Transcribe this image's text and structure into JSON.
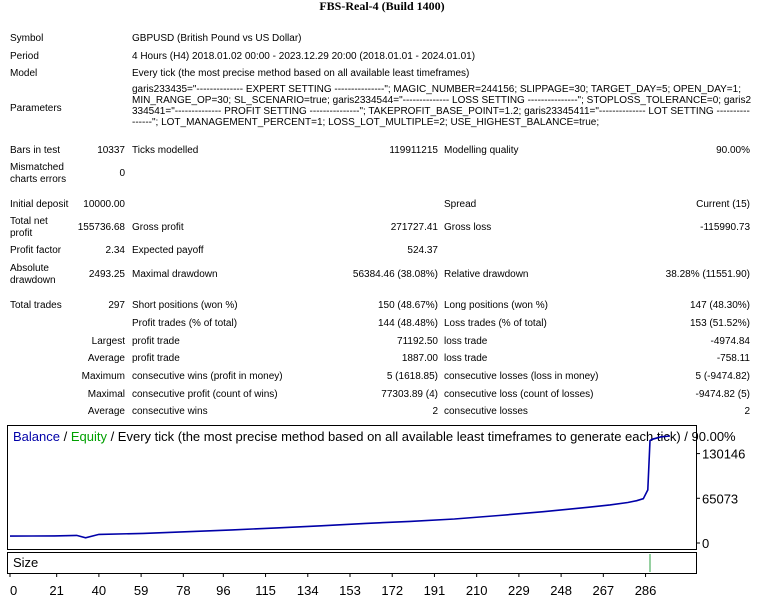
{
  "report": {
    "title": "FBS-Real-4 (Build 1400)",
    "symbol": {
      "label": "Symbol",
      "value": "GBPUSD (British Pound vs US Dollar)"
    },
    "period": {
      "label": "Period",
      "value": "4 Hours (H4) 2018.01.02 00:00 - 2023.12.29 20:00 (2018.01.01 - 2024.01.01)"
    },
    "model": {
      "label": "Model",
      "value": "Every tick (the most precise method based on all available least timeframes)"
    },
    "parameters": {
      "label": "Parameters",
      "value": "garis233435=\"-------------- EXPERT SETTING ---------------\"; MAGIC_NUMBER=244156; SLIPPAGE=30; TARGET_DAY=5; OPEN_DAY=1; MIN_RANGE_OP=30; SL_SCENARIO=true; garis2334544=\"-------------- LOSS SETTING ---------------\"; STOPLOSS_TOLERANCE=0; garis2334541=\"-------------- PROFIT SETTING ---------------\"; TAKEPROFIT_BASE_POINT=1.2; garis23345411=\"-------------- LOT SETTING ----------------\"; LOT_MANAGEMENT_PERCENT=1; LOSS_LOT_MULTIPLE=2; USE_HIGHEST_BALANCE=true;"
    },
    "bars_in_test": {
      "label": "Bars in test",
      "value": "10337"
    },
    "ticks_modelled": {
      "label": "Ticks modelled",
      "value": "119911215"
    },
    "modelling_quality": {
      "label": "Modelling quality",
      "value": "90.00%"
    },
    "mismatched": {
      "label": "Mismatched charts errors",
      "value": "0"
    },
    "initial_deposit": {
      "label": "Initial deposit",
      "value": "10000.00"
    },
    "spread": {
      "label": "Spread",
      "value": "Current (15)"
    },
    "total_net_profit": {
      "label": "Total net profit",
      "value": "155736.68"
    },
    "gross_profit": {
      "label": "Gross profit",
      "value": "271727.41"
    },
    "gross_loss": {
      "label": "Gross loss",
      "value": "-115990.73"
    },
    "profit_factor": {
      "label": "Profit factor",
      "value": "2.34"
    },
    "expected_payoff": {
      "label": "Expected payoff",
      "value": "524.37"
    },
    "absolute_drawdown": {
      "label": "Absolute drawdown",
      "value": "2493.25"
    },
    "maximal_drawdown": {
      "label": "Maximal drawdown",
      "value": "56384.46 (38.08%)"
    },
    "relative_drawdown": {
      "label": "Relative drawdown",
      "value": "38.28% (11551.90)"
    },
    "total_trades": {
      "label": "Total trades",
      "value": "297"
    },
    "short_positions": {
      "label": "Short positions (won %)",
      "value": "150 (48.67%)"
    },
    "long_positions": {
      "label": "Long positions (won %)",
      "value": "147 (48.30%)"
    },
    "profit_trades": {
      "label": "Profit trades (% of total)",
      "value": "144 (48.48%)"
    },
    "loss_trades": {
      "label": "Loss trades (% of total)",
      "value": "153 (51.52%)"
    },
    "largest": {
      "label": "Largest",
      "profit_label": "profit trade",
      "profit_value": "71192.50",
      "loss_label": "loss trade",
      "loss_value": "-4974.84"
    },
    "average": {
      "label": "Average",
      "profit_label": "profit trade",
      "profit_value": "1887.00",
      "loss_label": "loss trade",
      "loss_value": "-758.11"
    },
    "maximum": {
      "label": "Maximum",
      "profit_label": "consecutive wins (profit in money)",
      "profit_value": "5 (1618.85)",
      "loss_label": "consecutive losses (loss in money)",
      "loss_value": "5 (-9474.82)"
    },
    "maximal": {
      "label": "Maximal",
      "profit_label": "consecutive profit (count of wins)",
      "profit_value": "77303.89 (4)",
      "loss_label": "consecutive loss (count of losses)",
      "loss_value": "-9474.82 (5)"
    },
    "average_consecutive": {
      "label": "Average",
      "profit_label": "consecutive wins",
      "profit_value": "2",
      "loss_label": "consecutive losses",
      "loss_value": "2"
    }
  },
  "chart_data": {
    "type": "line",
    "legend": {
      "balance": "Balance",
      "separator1": " / ",
      "equity": "Equity",
      "rest": " / Every tick (the most precise method based on all available least timeframes to generate each tick) / 90.00%"
    },
    "ylim": [
      0,
      155737
    ],
    "yticks": [
      "130146",
      "65073",
      "0"
    ],
    "ytick_values": [
      130146,
      65073,
      0
    ],
    "xticks": [
      "0",
      "21",
      "40",
      "59",
      "78",
      "96",
      "115",
      "134",
      "153",
      "172",
      "191",
      "210",
      "229",
      "248",
      "267",
      "286"
    ],
    "xtick_values": [
      0,
      21,
      40,
      59,
      78,
      96,
      115,
      134,
      153,
      172,
      191,
      210,
      229,
      248,
      267,
      286
    ],
    "xlim": [
      0,
      297
    ],
    "series": [
      {
        "name": "Balance",
        "color": "#0000a8",
        "x": [
          0,
          10,
          20,
          30,
          34,
          40,
          60,
          80,
          100,
          120,
          140,
          160,
          180,
          200,
          220,
          240,
          260,
          270,
          278,
          282,
          285,
          287,
          288,
          289,
          293,
          297
        ],
        "y": [
          10000,
          10200,
          10400,
          11000,
          7500,
          12500,
          14000,
          16500,
          19000,
          22000,
          25000,
          28500,
          31500,
          35000,
          40000,
          45500,
          52000,
          55500,
          59000,
          61500,
          64500,
          77303,
          149000,
          151000,
          154500,
          155737
        ]
      },
      {
        "name": "Equity",
        "color": "#00a000",
        "x": [
          0,
          297
        ],
        "y": [
          10000,
          155737
        ]
      }
    ],
    "size_panel": {
      "label": "Size",
      "bar_x": 288,
      "bar_color": "#2ea043"
    },
    "colors": {
      "balance": "#0000a8",
      "equity": "#00a000",
      "axis": "#000000",
      "grid": "#ffffff"
    }
  }
}
